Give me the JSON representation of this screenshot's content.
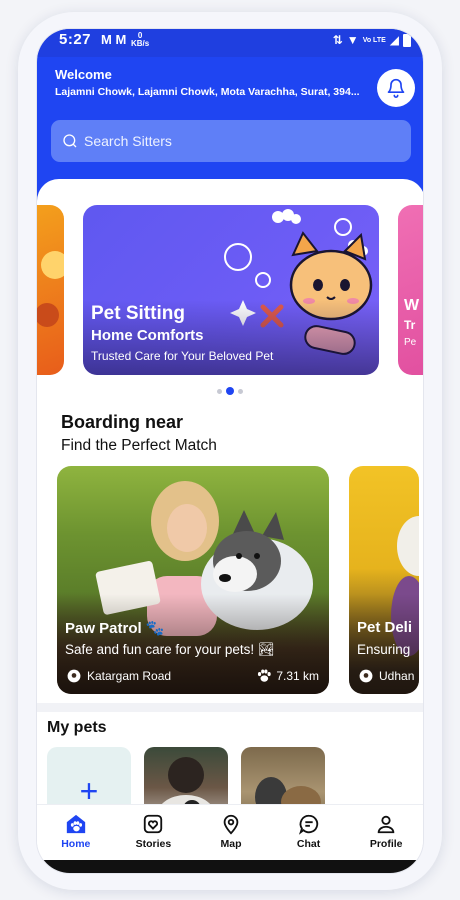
{
  "status_bar": {
    "time": "5:27",
    "notif": "M M",
    "speed_value": "0",
    "speed_unit": "KB/s",
    "network": "Vo LTE"
  },
  "header": {
    "welcome": "Welcome",
    "address": "Lajamni Chowk, Lajamni Chowk, Mota Varachha, Surat, 394...",
    "search_placeholder": "Search Sitters"
  },
  "banners": [
    {
      "title": "Pet Sitting",
      "subtitle": "Home Comforts",
      "description": "Trusted Care for Your Beloved Pet"
    },
    {
      "title": "W",
      "subtitle": "Tr",
      "description": "Pe"
    }
  ],
  "boarding": {
    "title": "Boarding near",
    "subtitle": "Find the Perfect Match",
    "cards": [
      {
        "name": "Paw Patrol 🐾",
        "tagline": "Safe and fun care for your pets! 🏞",
        "location": "Katargam Road",
        "distance": "7.31 km"
      },
      {
        "name": "Pet Deli",
        "tagline": "Ensuring",
        "location": "Udhan"
      }
    ]
  },
  "my_pets": {
    "title": "My pets",
    "add_symbol": "+"
  },
  "tabs": [
    {
      "label": "Home",
      "icon": "paw-house-icon",
      "active": true
    },
    {
      "label": "Stories",
      "icon": "heart-frame-icon",
      "active": false
    },
    {
      "label": "Map",
      "icon": "map-pin-icon",
      "active": false
    },
    {
      "label": "Chat",
      "icon": "chat-bubble-icon",
      "active": false
    },
    {
      "label": "Profile",
      "icon": "person-icon",
      "active": false
    }
  ],
  "colors": {
    "primary": "#1f45f2",
    "search_bg": "#5f7ff7",
    "banner": "#6c5cf5"
  }
}
